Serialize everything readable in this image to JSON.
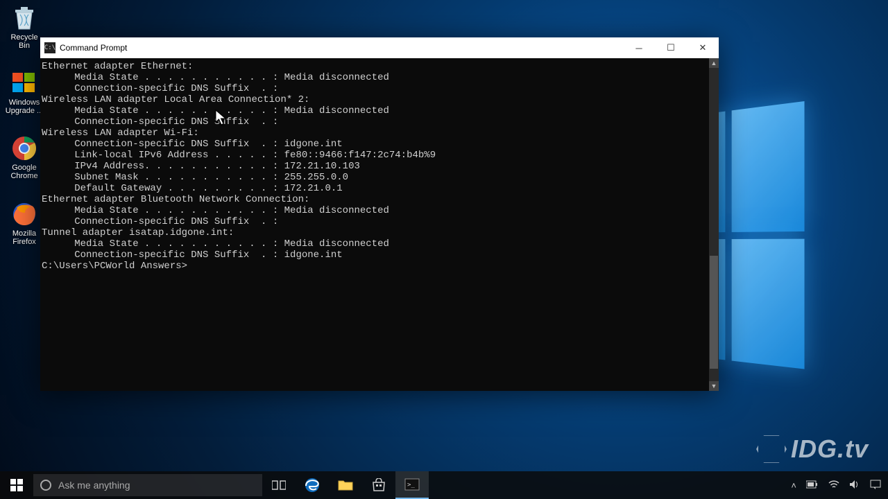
{
  "desktop": {
    "icons": [
      {
        "name": "recycle-bin",
        "label": "Recycle Bin"
      },
      {
        "name": "windows-upgrade",
        "label": "Windows Upgrade ..."
      },
      {
        "name": "google-chrome",
        "label": "Google Chrome"
      },
      {
        "name": "mozilla-firefox",
        "label": "Mozilla Firefox"
      }
    ]
  },
  "window": {
    "title": "Command Prompt"
  },
  "terminal": {
    "sections": [
      {
        "header": "Ethernet adapter Ethernet:",
        "rows": [
          "Media State . . . . . . . . . . . : Media disconnected",
          "Connection-specific DNS Suffix  . :"
        ]
      },
      {
        "header": "Wireless LAN adapter Local Area Connection* 2:",
        "rows": [
          "Media State . . . . . . . . . . . : Media disconnected",
          "Connection-specific DNS Suffix  . :"
        ]
      },
      {
        "header": "Wireless LAN adapter Wi-Fi:",
        "rows": [
          "Connection-specific DNS Suffix  . : idgone.int",
          "Link-local IPv6 Address . . . . . : fe80::9466:f147:2c74:b4b%9",
          "IPv4 Address. . . . . . . . . . . : 172.21.10.103",
          "Subnet Mask . . . . . . . . . . . : 255.255.0.0",
          "Default Gateway . . . . . . . . . : 172.21.0.1"
        ]
      },
      {
        "header": "Ethernet adapter Bluetooth Network Connection:",
        "rows": [
          "Media State . . . . . . . . . . . : Media disconnected",
          "Connection-specific DNS Suffix  . :"
        ]
      },
      {
        "header": "Tunnel adapter isatap.idgone.int:",
        "rows": [
          "Media State . . . . . . . . . . . : Media disconnected",
          "Connection-specific DNS Suffix  . : idgone.int"
        ]
      }
    ],
    "prompt": "C:\\Users\\PCWorld Answers>"
  },
  "taskbar": {
    "search_placeholder": "Ask me anything"
  },
  "watermark": {
    "text": "IDG.tv"
  }
}
